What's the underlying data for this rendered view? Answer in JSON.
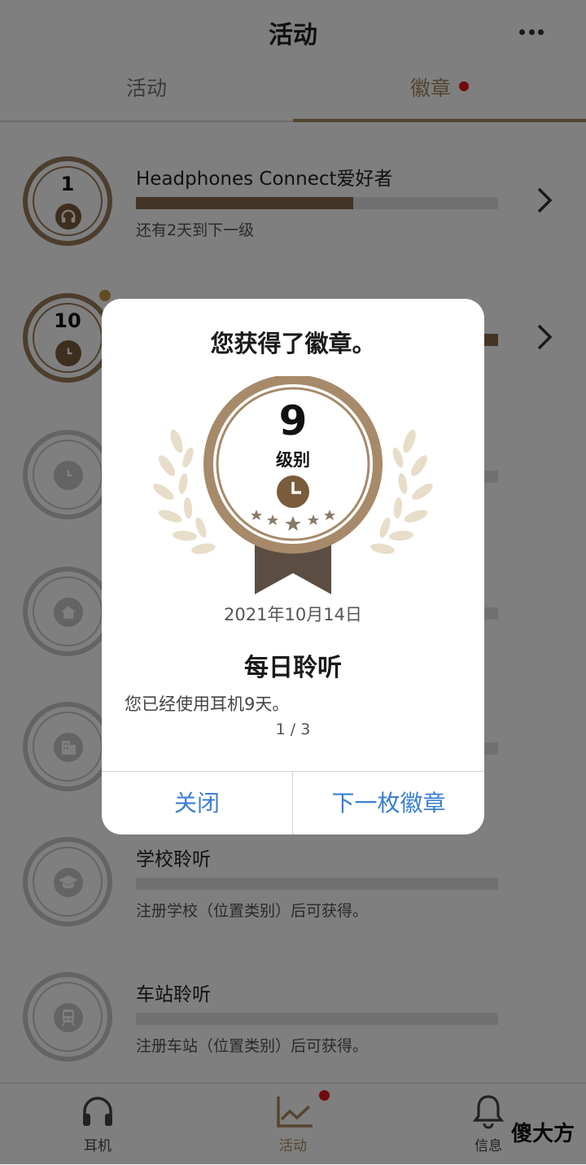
{
  "header": {
    "title": "活动",
    "more_icon": "more-horizontal-icon"
  },
  "tabs": [
    {
      "label": "活动",
      "active": false
    },
    {
      "label": "徽章",
      "active": true,
      "has_notification": true
    }
  ],
  "badges": [
    {
      "level": "1",
      "icon": "headphones-icon",
      "name": "Headphones Connect爱好者",
      "progress": 0.6,
      "subtitle": "还有2天到下一级",
      "earned": true
    },
    {
      "level": "10",
      "icon": "clock-icon",
      "name": "",
      "progress": 1.0,
      "subtitle": "",
      "earned": true,
      "new": true
    },
    {
      "icon": "clock-icon",
      "earned": false
    },
    {
      "icon": "home-icon",
      "earned": false
    },
    {
      "icon": "building-icon",
      "earned": false
    },
    {
      "icon": "graduation-cap-icon",
      "name": "学校聆听",
      "progress": 0,
      "subtitle": "注册学校（位置类别）后可获得。",
      "earned": false
    },
    {
      "icon": "train-icon",
      "name": "车站聆听",
      "progress": 0,
      "subtitle": "注册车站（位置类别）后可获得。",
      "earned": false
    }
  ],
  "bottom_nav": [
    {
      "label": "耳机",
      "icon": "headphones-icon",
      "active": false
    },
    {
      "label": "活动",
      "icon": "activity-chart-icon",
      "active": true,
      "has_notification": true
    },
    {
      "label": "信息",
      "icon": "bell-icon",
      "active": false
    }
  ],
  "watermark": "傻大方",
  "dialog": {
    "title": "您获得了徽章。",
    "badge_level": "9",
    "badge_level_label": "级别",
    "badge_icon": "clock-icon",
    "date": "2021年10月14日",
    "badge_name": "每日聆听",
    "description": "您已经使用耳机9天。",
    "pager": "1 / 3",
    "close_label": "关闭",
    "next_label": "下一枚徽章"
  },
  "colors": {
    "accent": "#a68a5f",
    "medal_brown": "#9a7a5a",
    "link_blue": "#3b7fd1",
    "notification_red": "#e21616"
  }
}
